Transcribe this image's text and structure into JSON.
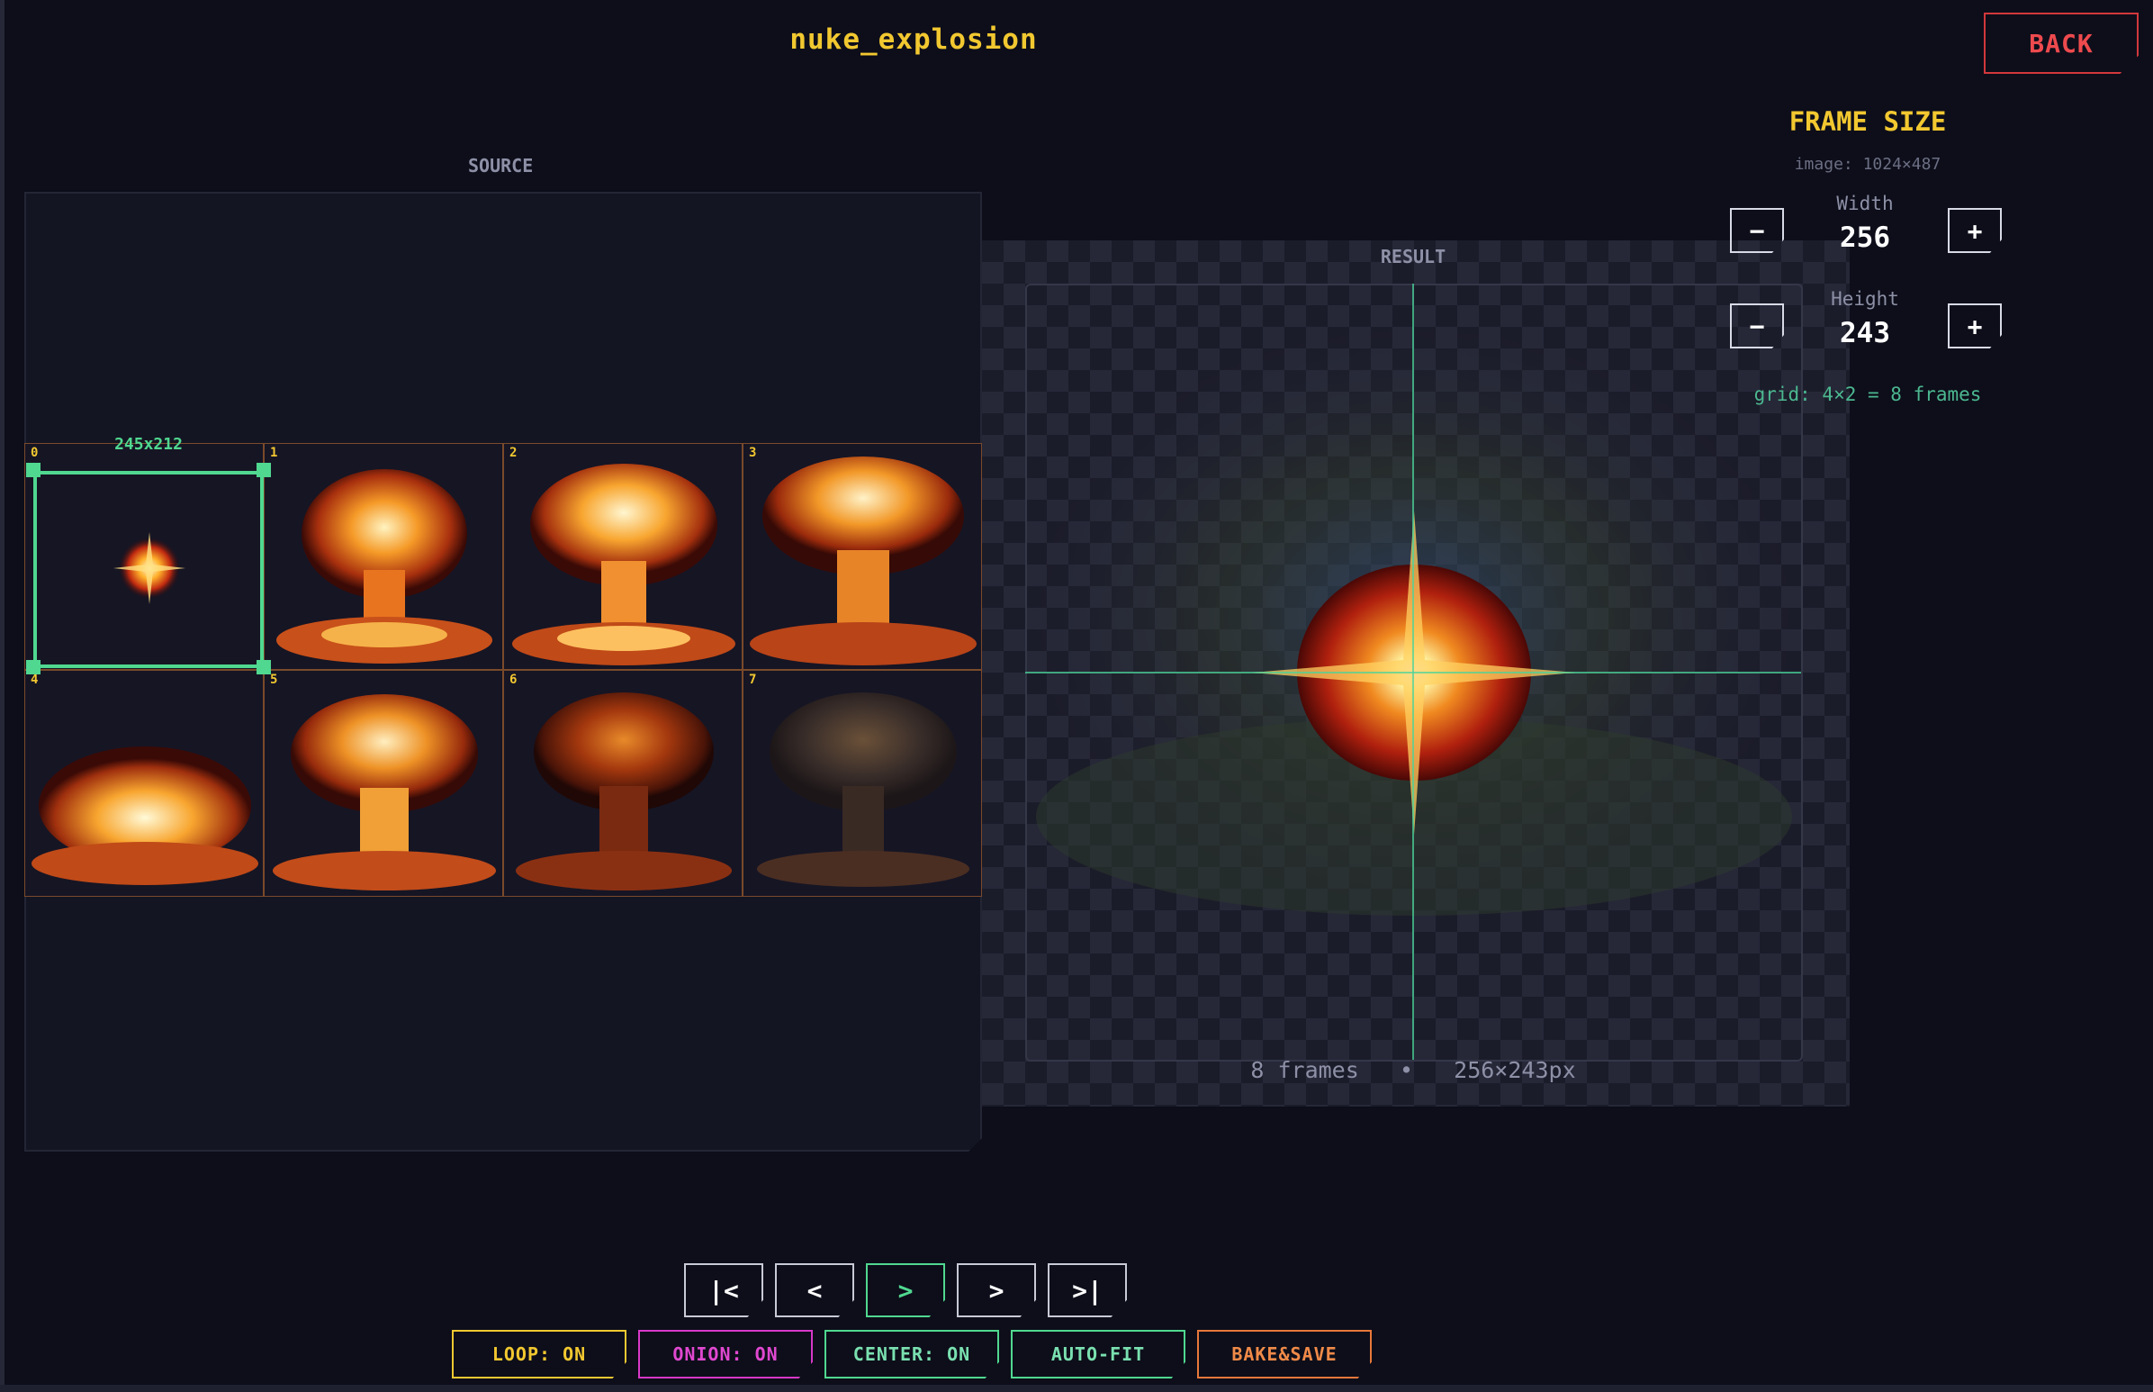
{
  "window": {
    "title": "nuke_explosion",
    "back_label": "BACK"
  },
  "source": {
    "label": "SOURCE",
    "selection_size": "245x212",
    "frames": [
      {
        "index": "0"
      },
      {
        "index": "1"
      },
      {
        "index": "2"
      },
      {
        "index": "3"
      },
      {
        "index": "4"
      },
      {
        "index": "5"
      },
      {
        "index": "6"
      },
      {
        "index": "7"
      }
    ]
  },
  "result": {
    "label": "RESULT",
    "frames_text": "8 frames",
    "separator": "•",
    "size_text": "256×243px"
  },
  "frame_size": {
    "title": "FRAME SIZE",
    "image_info": "image: 1024×487",
    "width_label": "Width",
    "width_value": "256",
    "height_label": "Height",
    "height_value": "243",
    "minus": "−",
    "plus": "+",
    "grid_info": "grid: 4×2 = 8 frames"
  },
  "playback": {
    "first": "|<",
    "prev": "<",
    "play": ">",
    "next": ">",
    "last": ">|"
  },
  "toggles": {
    "loop": "LOOP: ON",
    "onion": "ONION: ON",
    "center": "CENTER: ON",
    "autofit": "AUTO-FIT",
    "bake": "BAKE&SAVE"
  },
  "colors": {
    "accent_yellow": "#f2c830",
    "accent_green": "#50d890",
    "accent_magenta": "#d838c8",
    "accent_orange": "#e8783a",
    "danger_red": "#ee4a4e",
    "background": "#0d0e1a"
  }
}
